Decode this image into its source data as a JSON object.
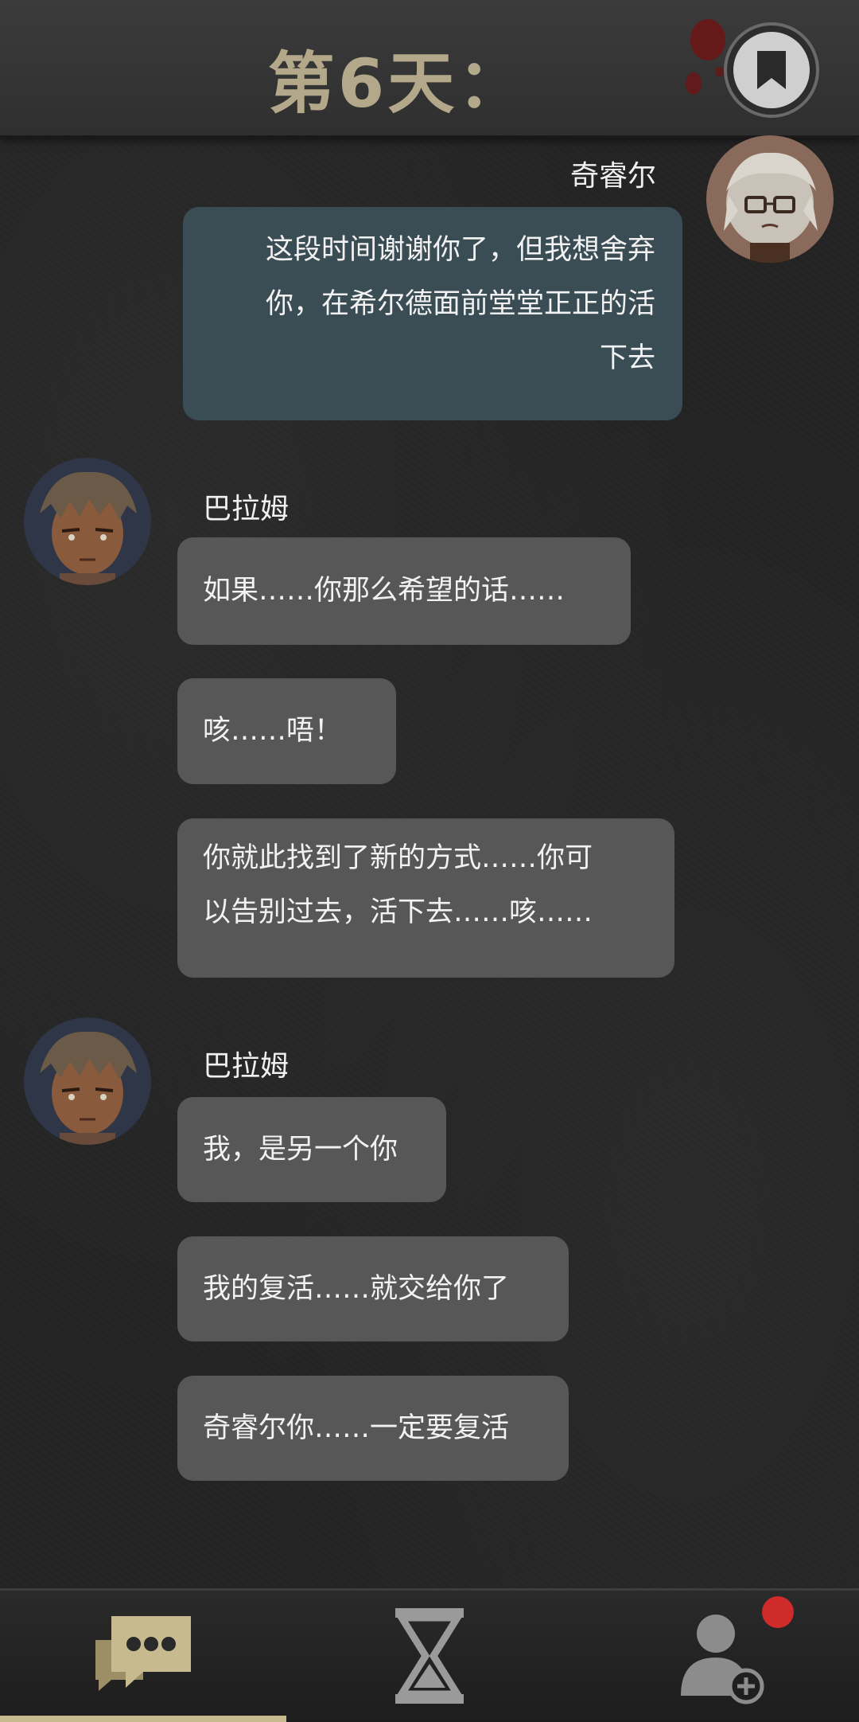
{
  "header": {
    "day_title": "第6天："
  },
  "colors": {
    "accent": "#c7ba8f",
    "other_bubble": "#575757",
    "self_bubble": "#3a4c54",
    "notification": "#d02b2b"
  },
  "messages": {
    "m0": {
      "sender": "奇睿尔",
      "lines": [
        "这段时间谢谢你了，但我想舍弃",
        "你，在希尔德面前堂堂正正的活",
        "下去"
      ]
    },
    "m1": {
      "sender": "巴拉姆",
      "lines": [
        "如果……你那么希望的话……"
      ]
    },
    "m2": {
      "lines": [
        "咳……唔！"
      ]
    },
    "m3": {
      "lines": [
        "你就此找到了新的方式……你可",
        "以告别过去，活下去……咳……"
      ]
    },
    "m4": {
      "sender": "巴拉姆",
      "lines": [
        "我，是另一个你"
      ]
    },
    "m5": {
      "lines": [
        "我的复活……就交给你了"
      ]
    },
    "m6": {
      "lines": [
        "奇睿尔你……一定要复活"
      ]
    }
  },
  "nav": {
    "chat": {
      "icon": "chat-bubbles-icon",
      "active": true
    },
    "timeline": {
      "icon": "hourglass-icon",
      "active": false
    },
    "contacts": {
      "icon": "add-user-icon",
      "active": false,
      "has_notification": true
    }
  }
}
